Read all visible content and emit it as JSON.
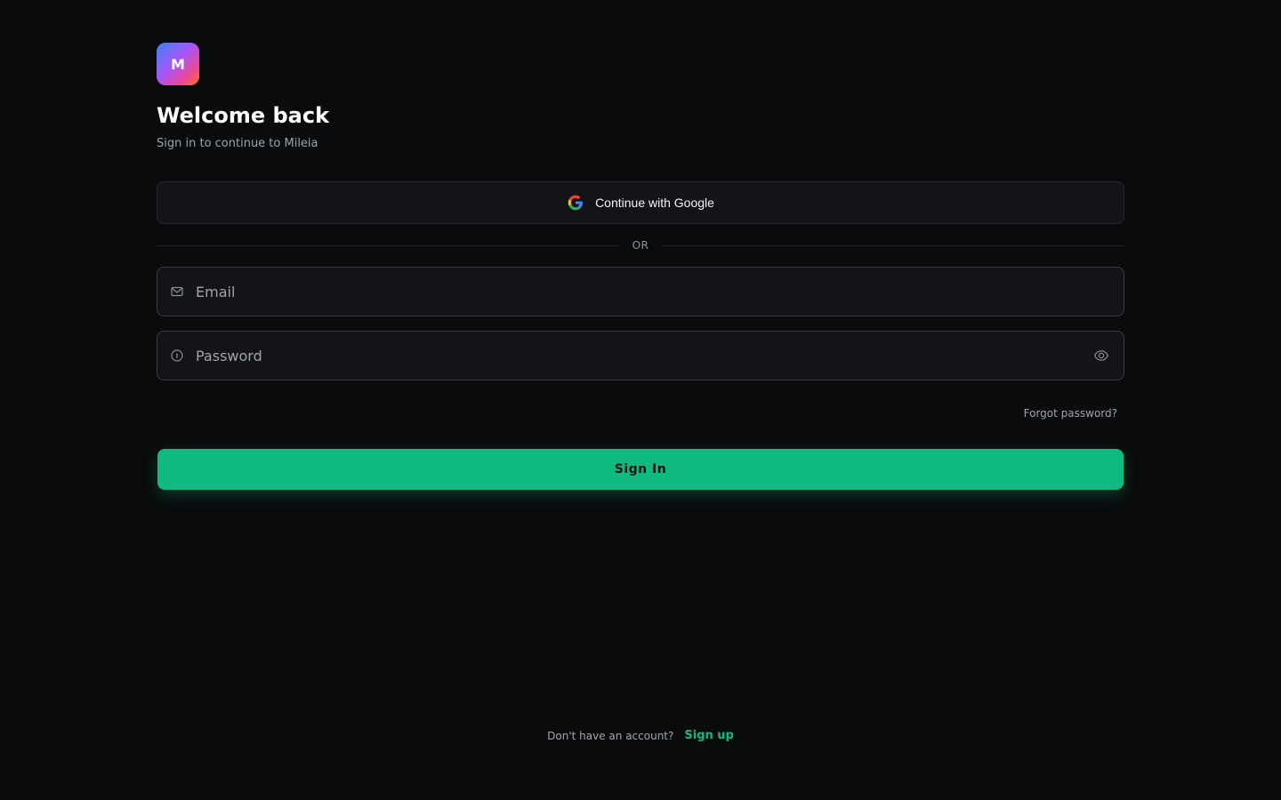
{
  "brand": {
    "logo_letter": "M",
    "gradient_colors": [
      "#3b82f6",
      "#a855f7",
      "#ec4899",
      "#f97316"
    ]
  },
  "header": {
    "title": "Welcome back",
    "subtitle": "Sign in to continue to Mileia"
  },
  "google_button": {
    "label": "Continue with Google",
    "icon": "google-icon"
  },
  "divider": {
    "label": "OR"
  },
  "email_field": {
    "placeholder": "Email",
    "value": "",
    "icon": "mail-icon"
  },
  "password_field": {
    "placeholder": "Password",
    "value": "",
    "icon": "lock-icon",
    "toggle_icon": "eye-icon"
  },
  "forgot_password": {
    "label": "Forgot password?"
  },
  "sign_in_button": {
    "label": "Sign In"
  },
  "footer": {
    "question": "Don't have an account?",
    "signup_label": "Sign up"
  },
  "colors": {
    "background": "#0a0b0d",
    "accent": "#10b981",
    "input_background": "#131417"
  }
}
